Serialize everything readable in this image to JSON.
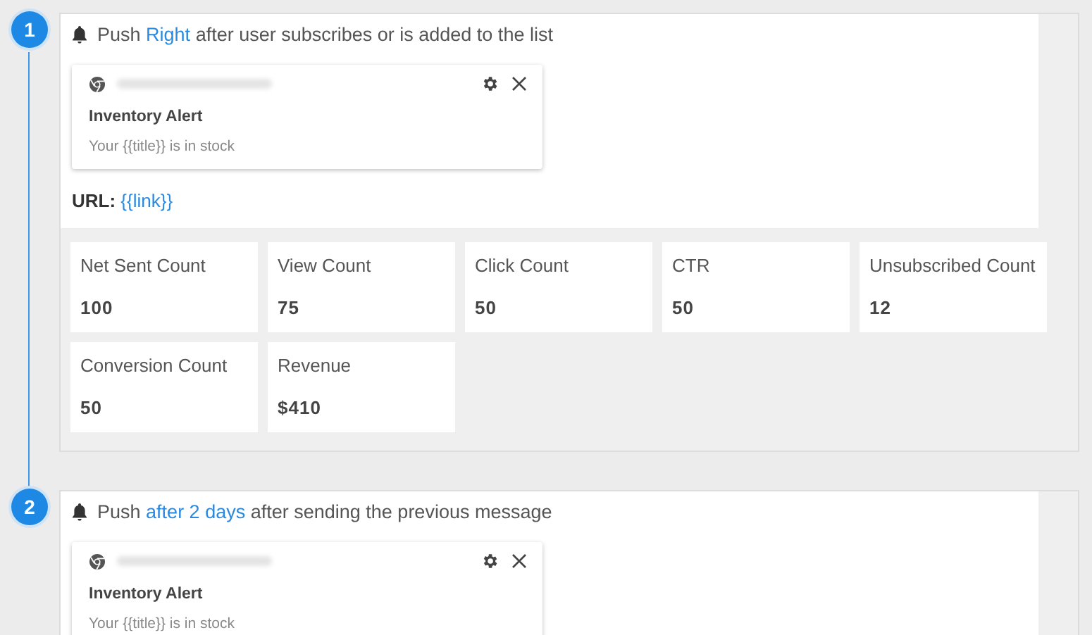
{
  "steps": [
    {
      "number": "1",
      "trigger": {
        "prefix": "Push",
        "timing": "Right",
        "suffix": "after user subscribes or is added to the list"
      },
      "notification": {
        "title": "Inventory Alert",
        "body": "Your {{title}} is in stock"
      },
      "url": {
        "label": "URL:",
        "value": "{{link}}"
      },
      "stats": [
        {
          "label": "Net Sent Count",
          "value": "100"
        },
        {
          "label": "View Count",
          "value": "75"
        },
        {
          "label": "Click Count",
          "value": "50"
        },
        {
          "label": "CTR",
          "value": "50"
        },
        {
          "label": "Unsubscribed Count",
          "value": "12"
        },
        {
          "label": "Conversion Count",
          "value": "50"
        },
        {
          "label": "Revenue",
          "value": "$410"
        }
      ]
    },
    {
      "number": "2",
      "trigger": {
        "prefix": "Push",
        "timing": "after 2 days",
        "suffix": "after sending the previous message"
      },
      "notification": {
        "title": "Inventory Alert",
        "body": "Your {{title}} is in stock"
      }
    }
  ]
}
